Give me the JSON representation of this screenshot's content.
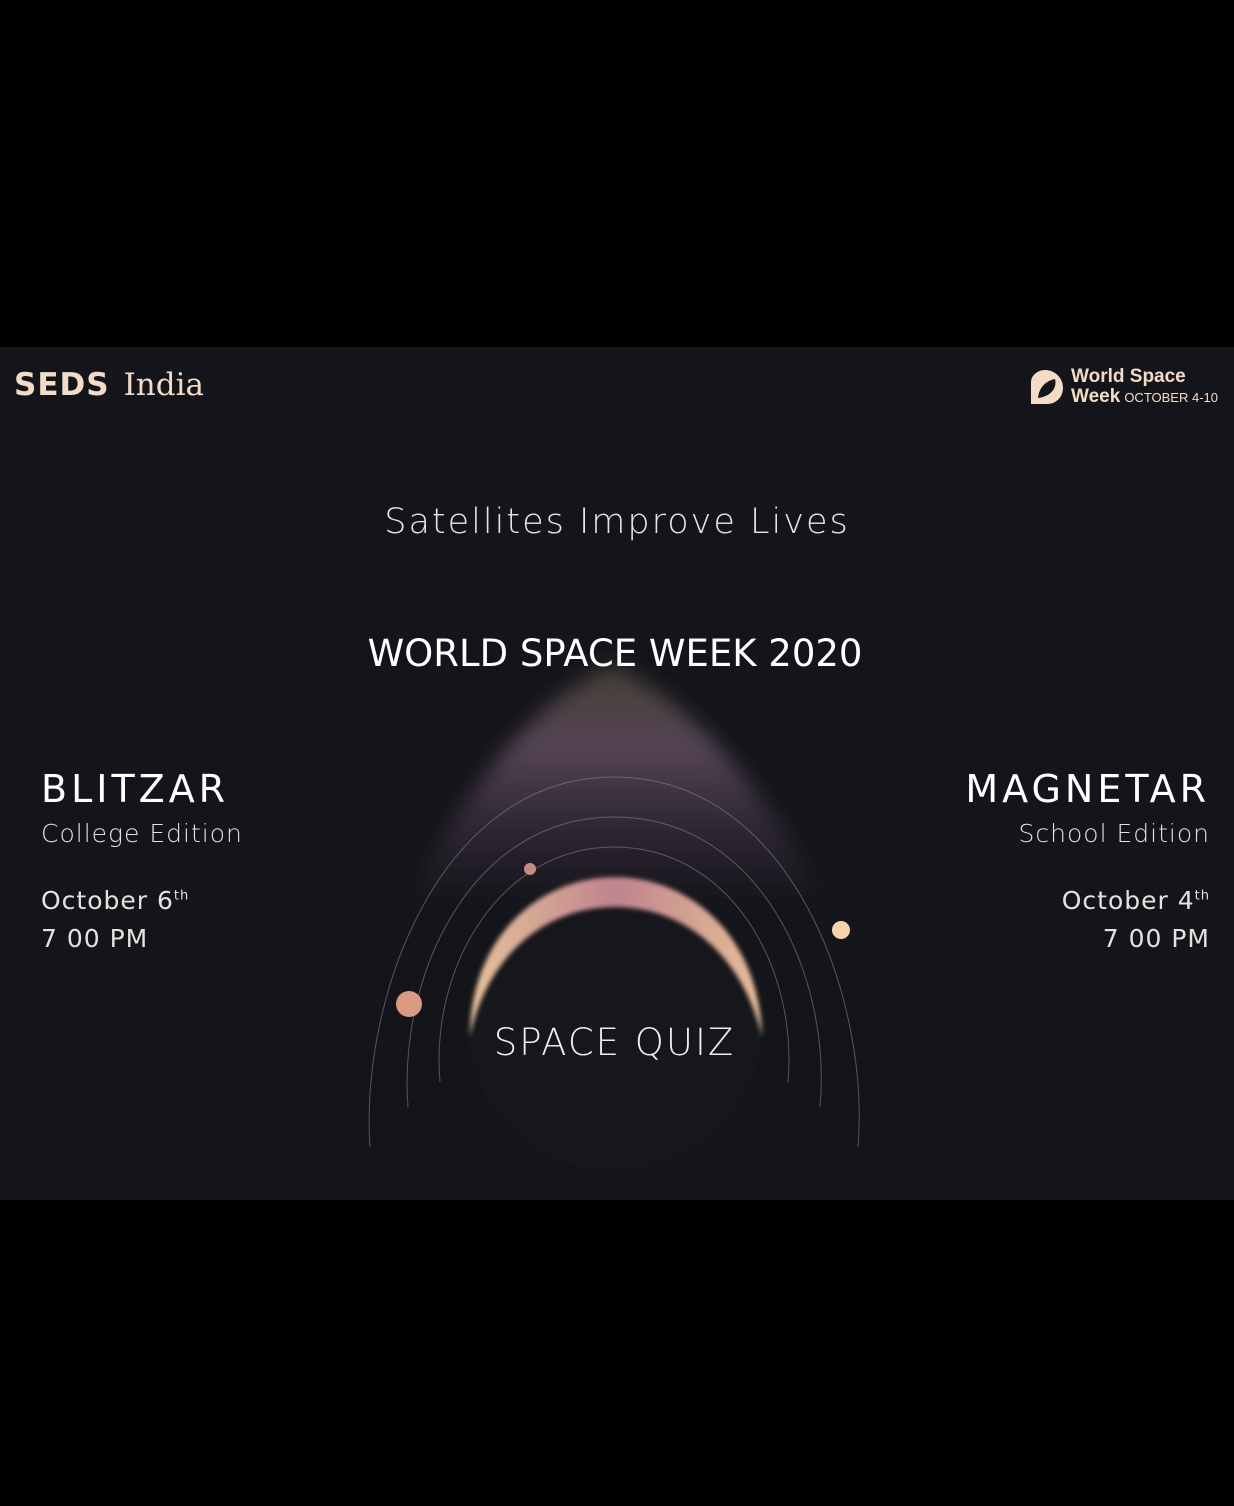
{
  "logos": {
    "left_org": "SEDS",
    "left_region": "India",
    "right_line1": "World Space",
    "right_line2": "Week",
    "right_dates": "OCTOBER 4-10"
  },
  "tagline": "Satellites Improve Lives",
  "title": "WORLD SPACE WEEK 2020",
  "left_event": {
    "name": "BLITZAR",
    "edition": "College Edition",
    "date": "October 6",
    "date_suffix": "th",
    "time": "7 00 PM"
  },
  "right_event": {
    "name": "MAGNETAR",
    "edition": "School Edition",
    "date": "October 4",
    "date_suffix": "th",
    "time": "7 00 PM"
  },
  "center_label": "SPACE QUIZ",
  "colors": {
    "background": "#14151a",
    "accent_peach": "#f3c9a2",
    "accent_pink": "#c78b95",
    "beam": "#8a6a86"
  }
}
